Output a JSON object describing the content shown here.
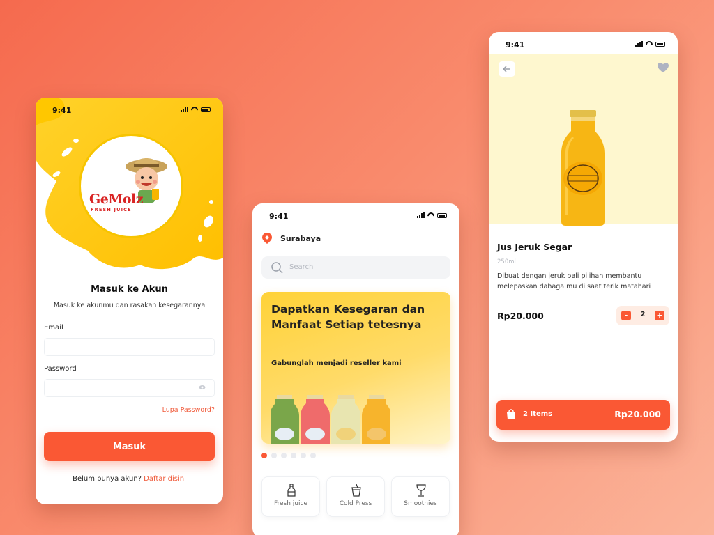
{
  "status_time": "9:41",
  "login": {
    "logo_text": "GeMolz",
    "logo_sub": "FRESH JUICE",
    "title": "Masuk ke Akun",
    "subtitle": "Masuk ke akunmu dan rasakan kesegarannya",
    "email_label": "Email",
    "email_value": "",
    "password_label": "Password",
    "password_value": "",
    "forgot": "Lupa Password?",
    "submit": "Masuk",
    "signup_prompt": "Belum punya akun?",
    "signup_link": "Daftar disini"
  },
  "home": {
    "location": "Surabaya",
    "search_placeholder": "Search",
    "banner_title": "Dapatkan Kesegaran dan Manfaat Setiap tetesnya",
    "banner_subtitle": "Gabunglah menjadi reseller kami",
    "carousel_total": 6,
    "carousel_active": 1,
    "categories": [
      {
        "label": "Fresh juice",
        "icon": "bottle-icon"
      },
      {
        "label": "Cold Press",
        "icon": "cup-icon"
      },
      {
        "label": "Smoothies",
        "icon": "glass-icon"
      }
    ]
  },
  "product": {
    "name": "Jus Jeruk Segar",
    "volume": "250ml",
    "description": "Dibuat dengan jeruk bali pilihan membantu melepaskan dahaga mu di saat terik matahari",
    "price": "Rp20.000",
    "quantity": "2",
    "minus": "-",
    "plus": "+",
    "cart_items": "2 Items",
    "cart_total": "Rp20.000"
  },
  "colors": {
    "accent": "#fa5834",
    "yellow": "#ffd237",
    "hero_bg": "#fef7cf"
  }
}
